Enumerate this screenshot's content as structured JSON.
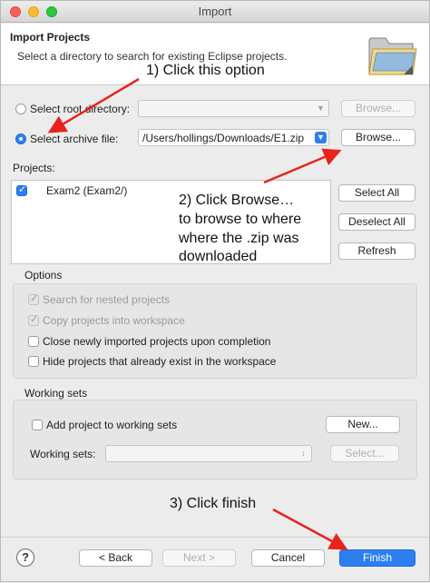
{
  "window": {
    "title": "Import"
  },
  "header": {
    "title": "Import Projects",
    "description": "Select a directory to search for existing Eclipse projects."
  },
  "annotations": {
    "step1": "1) Click this option",
    "step2_lines": [
      "2) Click Browse…",
      "to browse to where",
      "where the .zip was",
      "downloaded"
    ],
    "step3": "3) Click finish",
    "color": "#e8231b"
  },
  "source": {
    "root_dir_label": "Select root directory:",
    "root_dir_value": "",
    "root_browse": "Browse...",
    "archive_label": "Select archive file:",
    "archive_value": "/Users/hollings/Downloads/E1.zip",
    "archive_browse": "Browse...",
    "selected": "archive"
  },
  "projects": {
    "label": "Projects:",
    "items": [
      {
        "name": "Exam2 (Exam2/)",
        "checked": true
      }
    ],
    "select_all": "Select All",
    "deselect_all": "Deselect All",
    "refresh": "Refresh"
  },
  "options": {
    "title": "Options",
    "items": [
      {
        "label": "Search for nested projects",
        "checked": true,
        "enabled": false
      },
      {
        "label": "Copy projects into workspace",
        "checked": true,
        "enabled": false
      },
      {
        "label": "Close newly imported projects upon completion",
        "checked": false,
        "enabled": true
      },
      {
        "label": "Hide projects that already exist in the workspace",
        "checked": false,
        "enabled": true
      }
    ]
  },
  "working_sets": {
    "title": "Working sets",
    "add_label": "Add project to working sets",
    "new_button": "New...",
    "sets_label": "Working sets:",
    "select_button": "Select..."
  },
  "footer": {
    "help": "?",
    "back": "< Back",
    "next": "Next >",
    "cancel": "Cancel",
    "finish": "Finish"
  },
  "colors": {
    "accent": "#2d7ff0",
    "window_bg": "#ececec"
  }
}
